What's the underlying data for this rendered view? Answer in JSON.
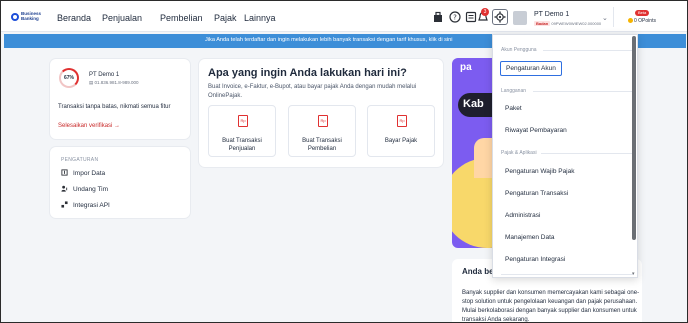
{
  "brand": {
    "line1": "Business",
    "line2": "Banking"
  },
  "nav": [
    "Beranda",
    "Penjualan",
    "Pembelian",
    "Pajak",
    "Lainnya"
  ],
  "notifications": {
    "count": "3"
  },
  "account": {
    "name": "PT Demo 1",
    "tag": "Badan",
    "id": "09PWEW0WIEW02.000000"
  },
  "points": {
    "beta": "Beta",
    "label": "0 OPoints"
  },
  "banner": {
    "text": "Jika Anda telah terdaftar dan ingin melakukan lebih banyak transaksi dengan tarif khusus, klik di sini"
  },
  "profile": {
    "progress": "67%",
    "name": "PT Demo 1",
    "npwp": "01.836.981.8-989.000",
    "desc": "Transaksi tanpa batas, nikmati semua fitur",
    "link": "Selesaikan verifikasi →"
  },
  "settings": {
    "title": "PENGATURAN",
    "items": [
      "Impor Data",
      "Undang Tim",
      "Integrasi API"
    ]
  },
  "main": {
    "heading": "Apa yang ingin Anda lakukan hari ini?",
    "sub": "Buat Invoice, e-Faktur, e-Bupot, atau bayar pajak Anda dengan mudah melalui OnlinePajak.",
    "actions": [
      {
        "label1": "Buat Transaksi",
        "label2": "Penjualan",
        "icon": "Rp"
      },
      {
        "label1": "Buat Transaksi",
        "label2": "Pembelian",
        "icon": "Rp"
      },
      {
        "label1": "Bayar Pajak",
        "label2": "",
        "icon": "Rp"
      }
    ]
  },
  "promo": {
    "brand": "pa",
    "kab": "Kab"
  },
  "info": {
    "heading": "Anda be",
    "text": "Banyak supplier dan konsumen memercayakan kami sebagai one-stop solution untuk pengelolaan keuangan dan pajak perusahaan. Mulai berkolaborasi dengan banyak supplier dan konsumen untuk transaksi Anda sekarang."
  },
  "dropdown": {
    "sections": [
      {
        "title": "Akun Pengguna",
        "items": [
          "Pengaturan Akun"
        ]
      },
      {
        "title": "Langganan",
        "items": [
          "Paket",
          "Riwayat Pembayaran"
        ]
      },
      {
        "title": "Pajak & Aplikasi",
        "items": [
          "Pengaturan Wajib Pajak",
          "Pengaturan Transaksi",
          "Administrasi",
          "Manajemen Data",
          "Pengaturan Integrasi"
        ]
      }
    ]
  }
}
